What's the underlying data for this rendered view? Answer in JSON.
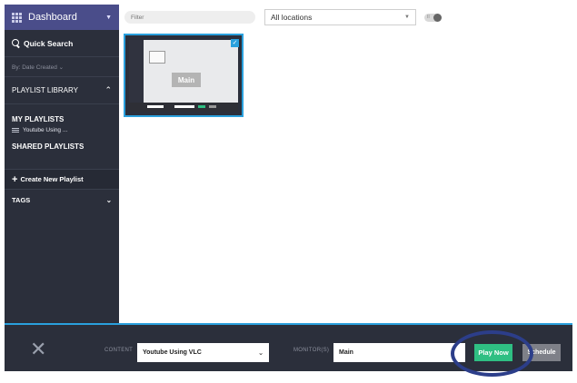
{
  "sidebar": {
    "dashboard_label": "Dashboard",
    "quick_search_label": "Quick Search",
    "sort_label": "By: Date Created ⌄",
    "playlist_library_label": "PLAYLIST LIBRARY",
    "my_playlists_label": "MY PLAYLISTS",
    "playlist_items": [
      {
        "label": "Youtube Using ..."
      }
    ],
    "shared_playlists_label": "SHARED PLAYLISTS",
    "create_playlist_label": "Create New Playlist",
    "tags_label": "TAGS"
  },
  "toolbar": {
    "filter_placeholder": "Filter",
    "location_value": "All locations",
    "toggle_text": "II"
  },
  "thumbnail": {
    "monitor_label": "Main",
    "selected": true
  },
  "bottom_bar": {
    "content_label": "CONTENT",
    "content_value": "Youtube Using VLC",
    "monitors_label": "MONITOR(S)",
    "monitors_value": "Main",
    "play_now_label": "Play Now",
    "schedule_label": "Schedule"
  },
  "colors": {
    "sidebar_bg": "#2b2f3b",
    "dashboard_bg": "#4a4d8a",
    "accent": "#2aa0dd",
    "play_button": "#2fbf83",
    "schedule_button": "#7e8088",
    "highlight_ring": "#2c3e8a"
  },
  "icons": [
    "dashboard-grid-icon",
    "search-icon",
    "chevron-up-icon",
    "list-icon",
    "plus-icon",
    "chevron-down-icon",
    "close-icon",
    "checkbox-icon"
  ]
}
